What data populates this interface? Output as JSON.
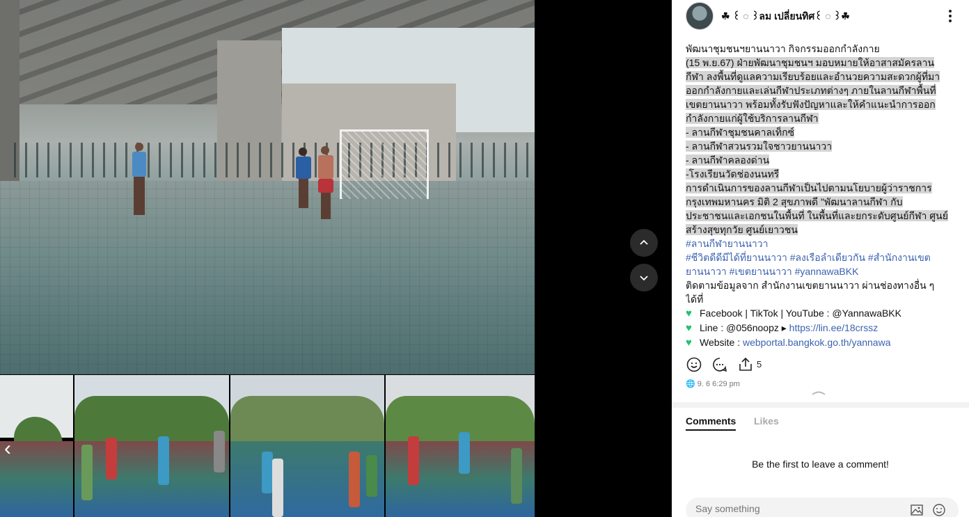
{
  "author": {
    "name": "☘ ꒰ ◌ ꒱ลม เปลี่ยนทิศ꒰ ◌ ꒱☘"
  },
  "post": {
    "lines": [
      {
        "text": "พัฒนาชุมชนฯยานนาวา กิจกรรมออกกำลังกาย",
        "style": "plain"
      },
      {
        "text": " (15 พ.ย.67)  ฝ่ายพัฒนาชุมชนฯ มอบหมายให้อาสาสมัครลาน",
        "style": "hl"
      },
      {
        "text": "กีฬา ลงพื้นที่ดูแลความเรียบร้อยและอำนวยความสะดวกผู้ที่มา",
        "style": "hl"
      },
      {
        "text": "ออกกำลังกายและเล่นกีฬาประเภทต่างๆ ภายในลานกีฬาพื้นที่",
        "style": "hl"
      },
      {
        "text": "เขตยานนาวา พร้อมทั้งรับฟังปัญหาและให้คำแนะนำการออก",
        "style": "hl"
      },
      {
        "text": "กำลังกายแก่ผู้ใช้บริการลานกีฬา",
        "style": "hl"
      },
      {
        "text": "- ลานกีฬาชุมชนคาลเท็กซ์",
        "style": "hl"
      },
      {
        "text": "- ลานกีฬาสวนรวมใจชาวยานนาวา",
        "style": "hl"
      },
      {
        "text": "- ลานกีฬาคลองด่าน",
        "style": "hl"
      },
      {
        "text": "-โรงเรียนวัดช่องนนทรี",
        "style": "hl"
      },
      {
        "text": "   การดำเนินการของลานกีฬาเป็นไปตามนโยบายผู้ว่าราชการ",
        "style": "hl"
      },
      {
        "text": "กรุงเทพมหานคร  มิติ 2 สุขภาพดี  \"พัฒนาลานกีฬา กับ",
        "style": "hl"
      },
      {
        "text": "ประชาชนและเอกชนในพื้นที่ ในพื้นที่และยกระดับศูนย์กีฬา ศูนย์",
        "style": "hl"
      },
      {
        "text": "สร้างสุขทุกวัย ศูนย์เยาวชน",
        "style": "hl"
      },
      {
        "text": "#ลานกีฬายานนาวา",
        "style": "tag"
      },
      {
        "text": "#ชีวิตดีดีมีได้ที่ยานนาวา #ลงเรือลำเดียวกัน #สำนักงานเขต",
        "style": "tag"
      },
      {
        "text": "ยานนาวา #เขตยานนาวา #yannawaBKK",
        "style": "tag"
      },
      {
        "text": "ติดตามข้อมูลจาก สำนักงานเขตยานนาวา ผ่านช่องทางอื่น ๆ",
        "style": "plain"
      },
      {
        "text": "ได้ที่",
        "style": "plain"
      }
    ],
    "contacts": [
      {
        "label": "Facebook | TikTok | YouTube : @YannawaBKK",
        "link": ""
      },
      {
        "label": "Line : @056noopz ▸ ",
        "link": "https://lin.ee/18crssz"
      },
      {
        "label": "Website : ",
        "link": "webportal.bangkok.go.th/yannawa"
      }
    ],
    "heart_icon": "green-heart-icon",
    "share_count": "5",
    "timestamp": "9. 6 6:29 pm"
  },
  "tabs": {
    "comments": "Comments",
    "likes": "Likes"
  },
  "empty_text": "Be the first to leave a comment!",
  "composer": {
    "placeholder": "Say something"
  },
  "colors": {
    "hashtag": "#3b62b0",
    "highlight": "#d4d4d4",
    "heart": "#20c46a"
  }
}
